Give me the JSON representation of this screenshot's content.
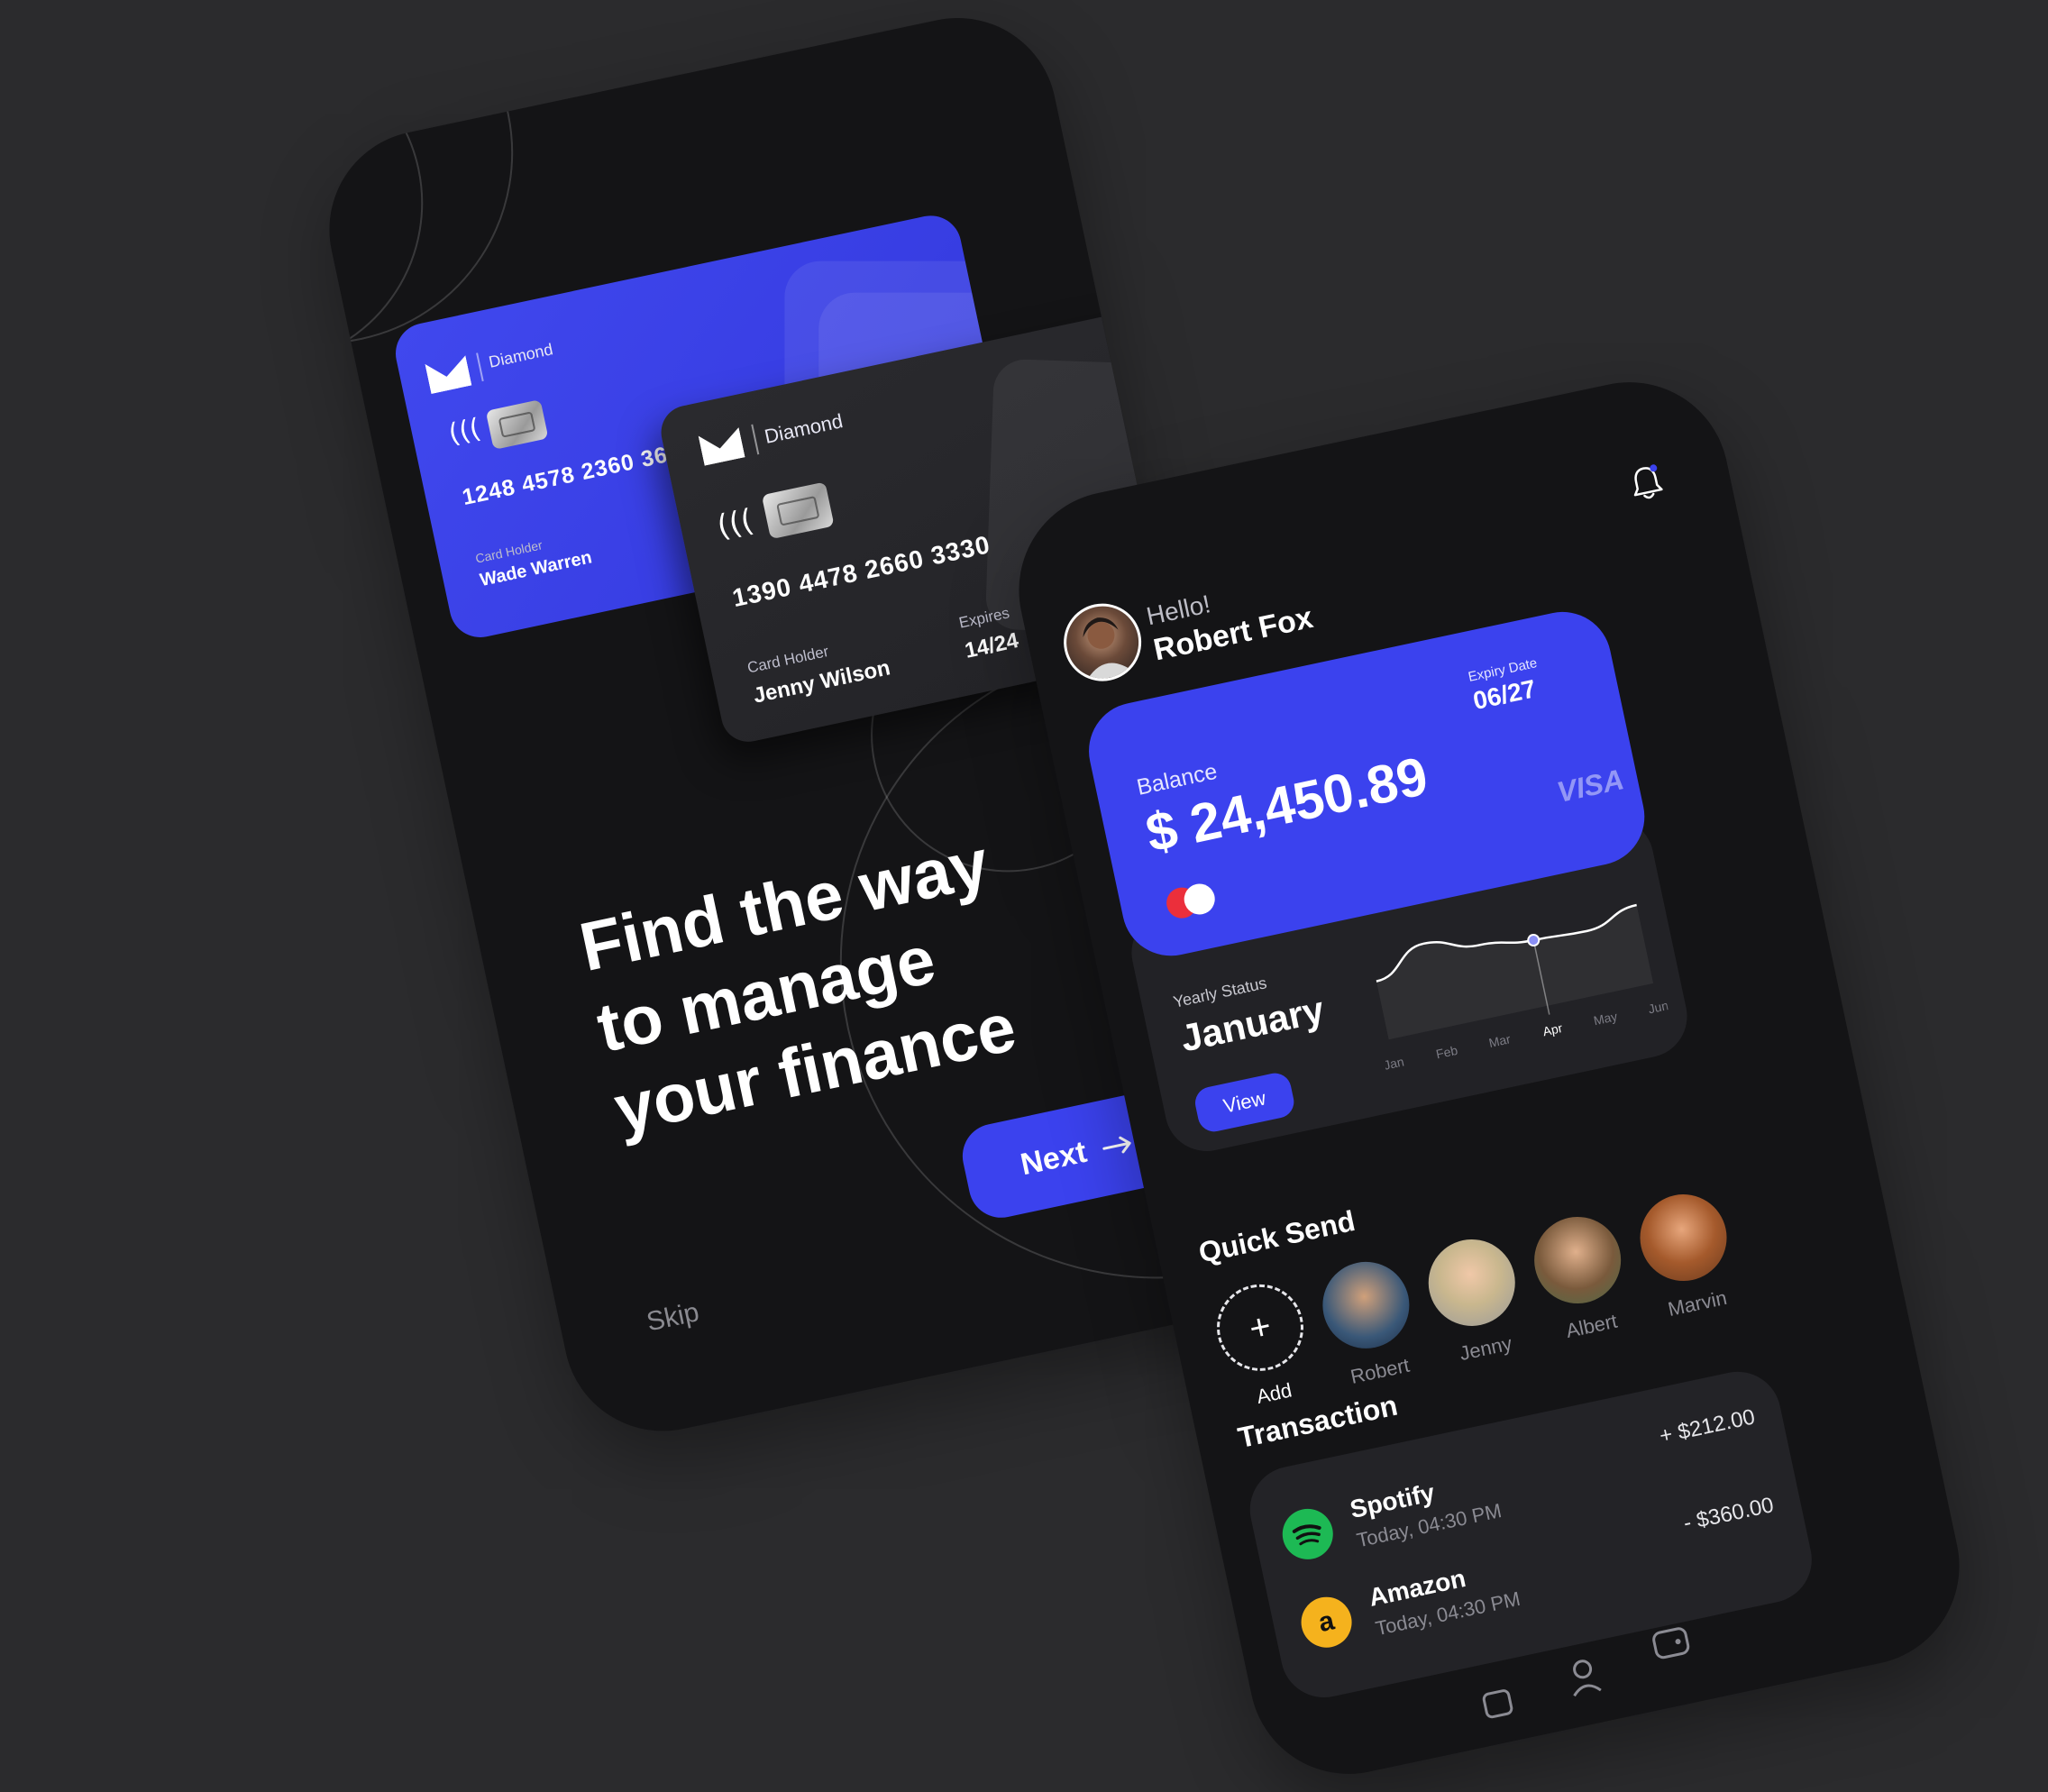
{
  "onboarding": {
    "blue_card": {
      "brand": "Diamond",
      "number": "1248 4578  2360 36",
      "holder_label": "Card Holder",
      "holder_name": "Wade Warren"
    },
    "dark_card": {
      "brand": "Diamond",
      "number": "1390 4478   2660 3330",
      "holder_label": "Card Holder",
      "holder_name": "Jenny Wilson",
      "expires_label": "Expires",
      "expires_value": "14/24"
    },
    "headline_lines": [
      "Find the way",
      "to manage",
      "your finance"
    ],
    "next_label": "Next",
    "skip_label": "Skip"
  },
  "dashboard": {
    "greeting": "Hello!",
    "user_name": "Robert Fox",
    "balance_card": {
      "balance_label": "Balance",
      "balance_value": "$ 24,450.89",
      "expiry_label": "Expiry Date",
      "expiry_value": "06/27",
      "network": "VISA"
    },
    "yearly_status": {
      "label": "Yearly Status",
      "month": "January",
      "view_label": "View"
    },
    "chart_data": {
      "type": "line",
      "categories": [
        "Jan",
        "Feb",
        "Mar",
        "Apr",
        "May",
        "Jun"
      ],
      "highlighted": "Apr",
      "values": [
        55,
        80,
        68,
        62,
        60,
        74
      ]
    },
    "quick_send": {
      "title": "Quick Send",
      "add_label": "Add",
      "contacts": [
        "Robert",
        "Jenny",
        "Albert",
        "Marvin"
      ]
    },
    "transactions": {
      "title": "Transaction",
      "items": [
        {
          "name": "Spotify",
          "time": "Today, 04:30 PM",
          "amount": "+ $212.00"
        },
        {
          "name": "Amazon",
          "time": "Today, 04:30 PM",
          "amount": "- $360.00"
        }
      ]
    }
  },
  "colors": {
    "background": "#2b2b2d",
    "phone": "#141416",
    "accent": "#3b42ee",
    "spotify": "#1db954",
    "amazon": "#f5b21d",
    "mastercard_red": "#eb2f3b"
  }
}
